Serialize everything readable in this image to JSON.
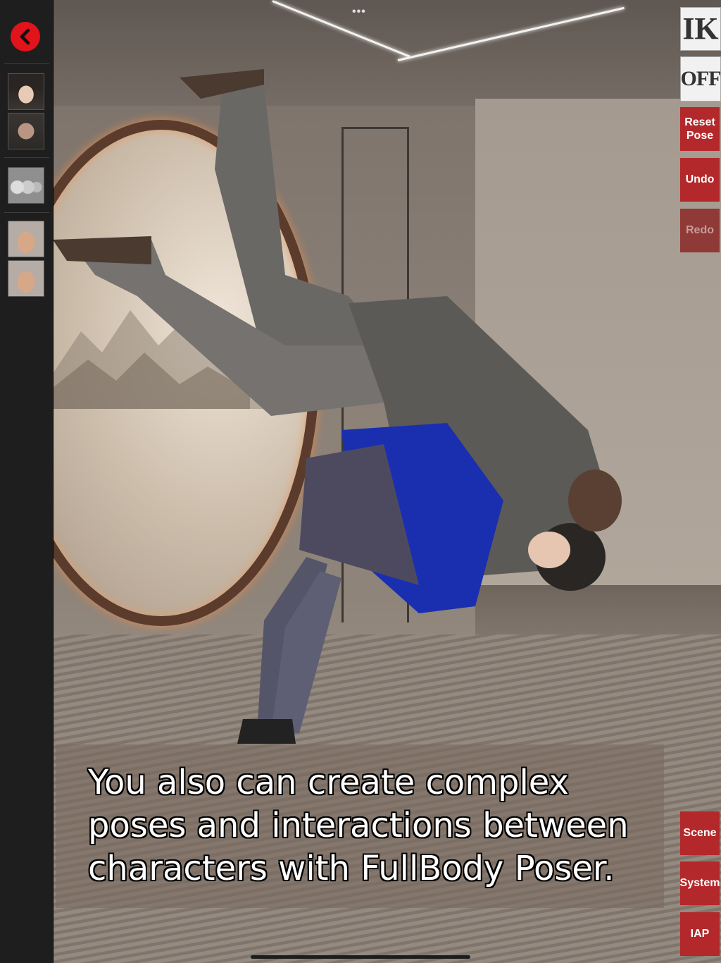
{
  "sidebar": {
    "back_label": "Back",
    "thumbnails": [
      {
        "name": "character-female-thumb",
        "kind": "face-female"
      },
      {
        "name": "character-male-thumb",
        "kind": "face-male"
      },
      {
        "name": "props-thumb",
        "kind": "items"
      },
      {
        "name": "hand-left-thumb",
        "kind": "hand"
      },
      {
        "name": "hand-right-thumb",
        "kind": "hand"
      }
    ]
  },
  "toolbar": {
    "ik_label": "IK",
    "off_label": "OFF",
    "reset_pose_line1": "Reset",
    "reset_pose_line2": "Pose",
    "undo_label": "Undo",
    "redo_label": "Redo",
    "scene_label": "Scene",
    "system_label": "System",
    "iap_label": "IAP"
  },
  "caption": {
    "line1": "You also can create complex",
    "line2": "poses and interactions between",
    "line3": "characters with FullBody Poser."
  },
  "top_handle": "•••",
  "colors": {
    "accent_red": "#b3282a",
    "back_button": "#e0141a",
    "sidebar_bg": "#1e1e1e"
  }
}
